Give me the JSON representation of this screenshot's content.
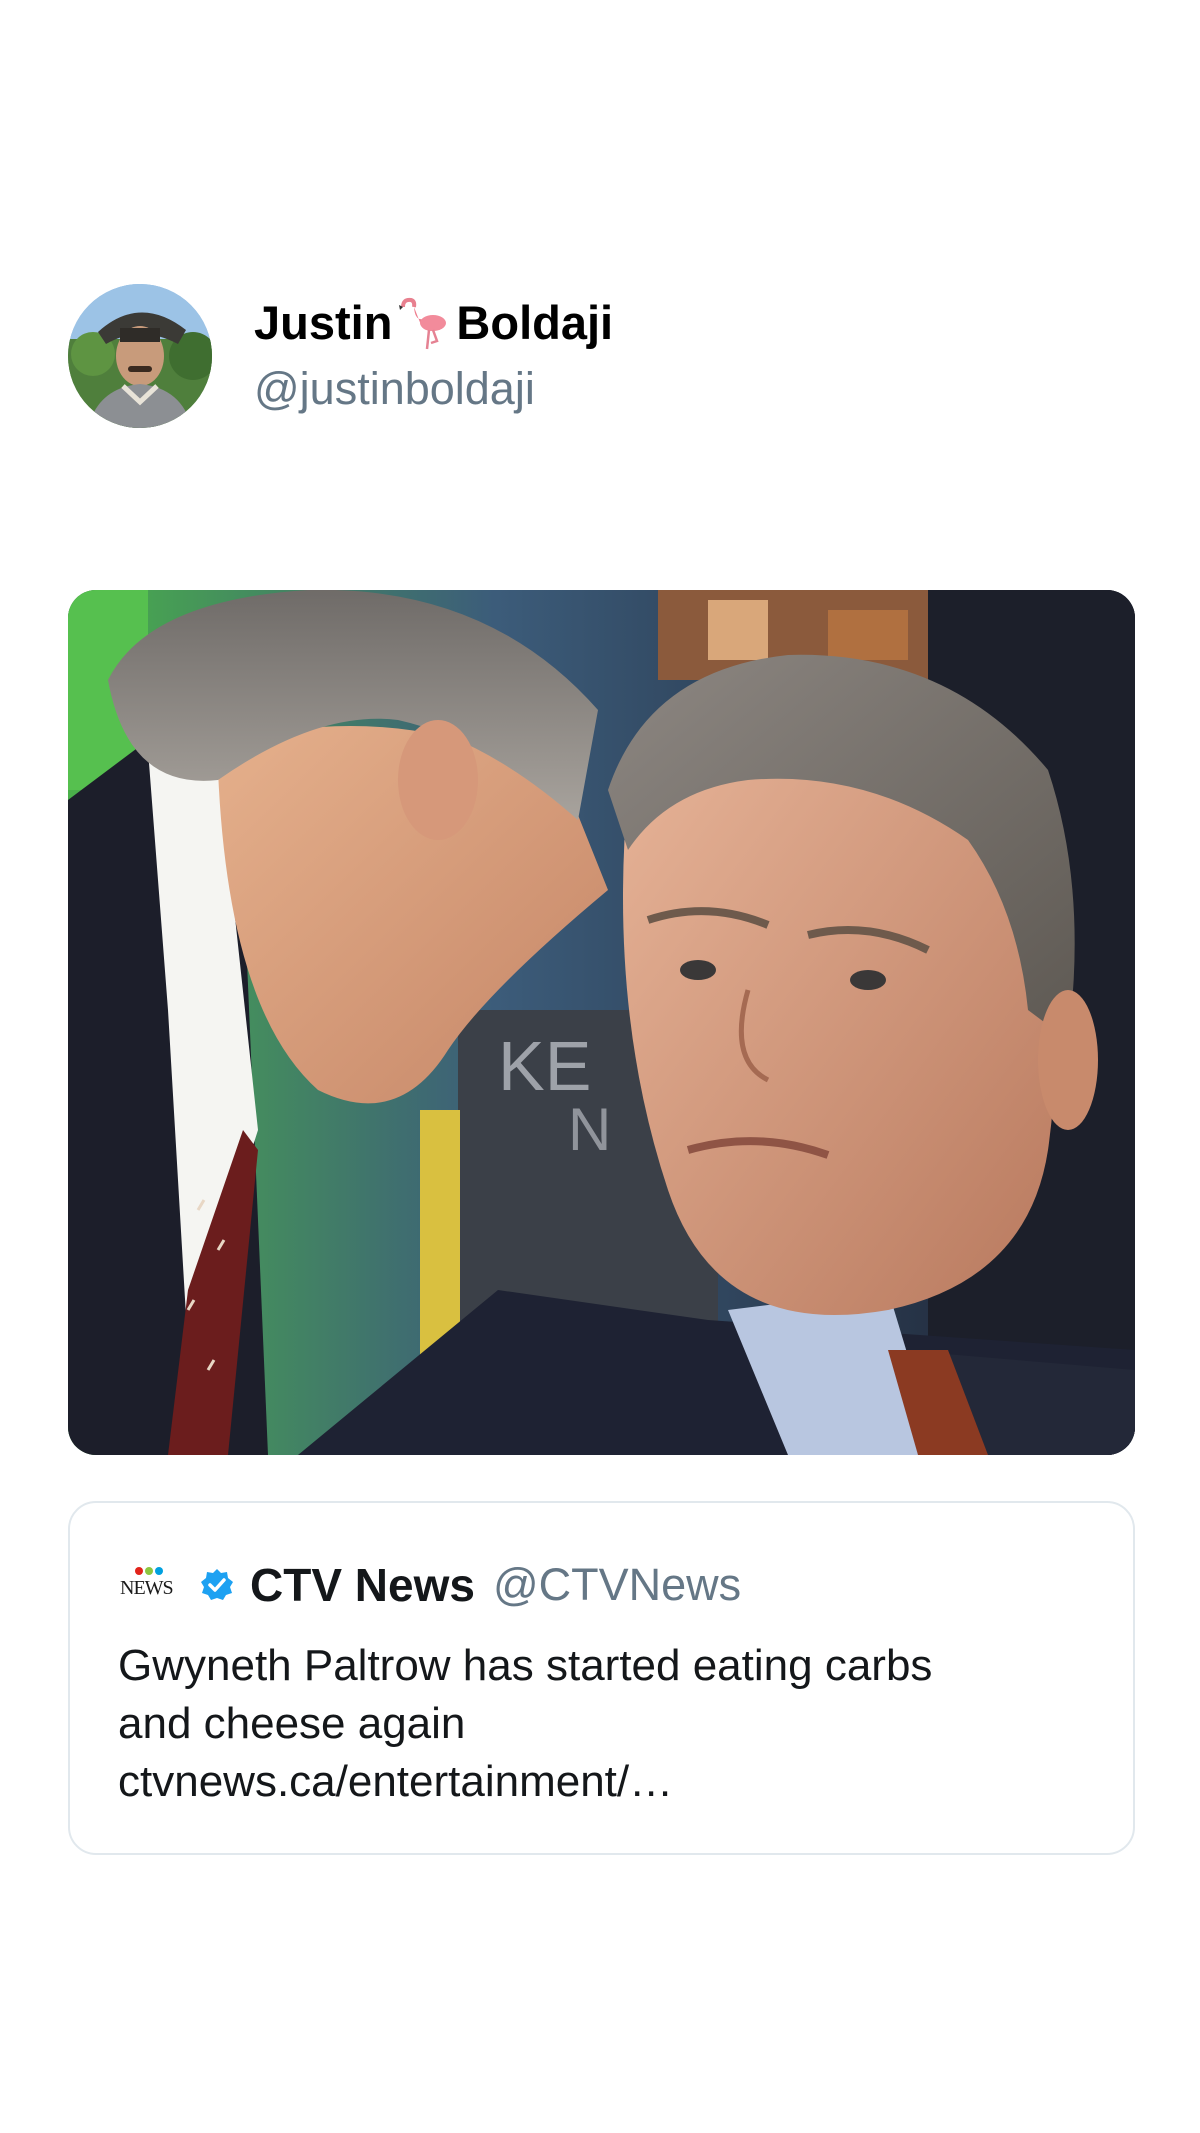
{
  "tweet": {
    "author": {
      "first_name": "Justin",
      "name_emoji": "flamingo-icon",
      "last_name": "Boldaji",
      "handle": "@justinboldaji"
    },
    "photo": {
      "description_icon": "photo"
    },
    "quoted": {
      "logo_text": "NEWS",
      "logo_dot_colors": [
        "#e2231a",
        "#8dc63f",
        "#00a0df"
      ],
      "verified_color": "#1da1f2",
      "name": "CTV News",
      "handle": "@CTVNews",
      "text_line_1": "Gwyneth Paltrow has started eating carbs",
      "text_line_2": "and cheese again",
      "link": "ctvnews.ca/entertainment/…"
    }
  },
  "colors": {
    "handle_gray": "#657786",
    "border": "#e1e8ed",
    "text": "#14171a"
  }
}
